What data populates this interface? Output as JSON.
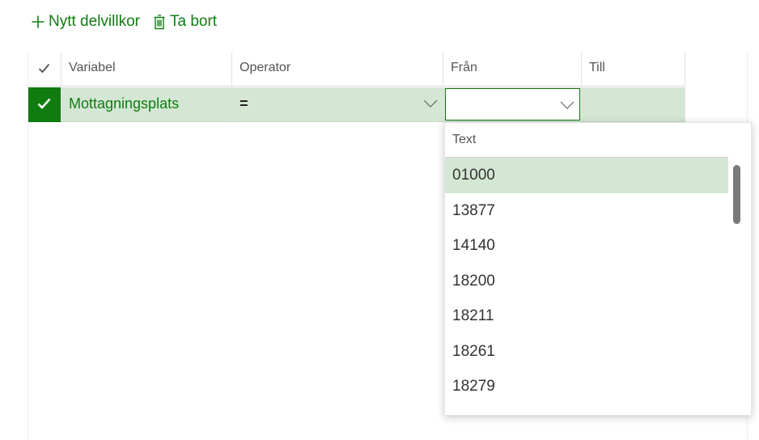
{
  "toolbar": {
    "add_label": "Nytt delvillkor",
    "delete_label": "Ta bort",
    "accent_color": "#107c10"
  },
  "grid": {
    "columns": [
      "Variabel",
      "Operator",
      "Från",
      "Till"
    ],
    "row": {
      "selected": true,
      "variabel": "Mottagningsplats",
      "operator": "=",
      "fran": "",
      "till": ""
    },
    "selected_row_color": "#d4e7d4"
  },
  "dropdown": {
    "header": "Text",
    "items": [
      "01000",
      "13877",
      "14140",
      "18200",
      "18211",
      "18261",
      "18279"
    ],
    "selected_index": 0
  }
}
